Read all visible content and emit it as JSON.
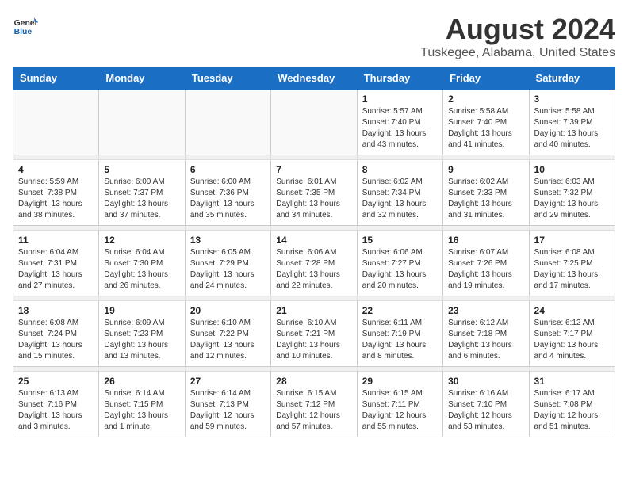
{
  "header": {
    "logo_general": "General",
    "logo_blue": "Blue",
    "month_title": "August 2024",
    "location": "Tuskegee, Alabama, United States"
  },
  "weekdays": [
    "Sunday",
    "Monday",
    "Tuesday",
    "Wednesday",
    "Thursday",
    "Friday",
    "Saturday"
  ],
  "weeks": [
    [
      {
        "day": "",
        "sunrise": "",
        "sunset": "",
        "daylight": ""
      },
      {
        "day": "",
        "sunrise": "",
        "sunset": "",
        "daylight": ""
      },
      {
        "day": "",
        "sunrise": "",
        "sunset": "",
        "daylight": ""
      },
      {
        "day": "",
        "sunrise": "",
        "sunset": "",
        "daylight": ""
      },
      {
        "day": "1",
        "sunrise": "Sunrise: 5:57 AM",
        "sunset": "Sunset: 7:40 PM",
        "daylight": "Daylight: 13 hours and 43 minutes."
      },
      {
        "day": "2",
        "sunrise": "Sunrise: 5:58 AM",
        "sunset": "Sunset: 7:40 PM",
        "daylight": "Daylight: 13 hours and 41 minutes."
      },
      {
        "day": "3",
        "sunrise": "Sunrise: 5:58 AM",
        "sunset": "Sunset: 7:39 PM",
        "daylight": "Daylight: 13 hours and 40 minutes."
      }
    ],
    [
      {
        "day": "4",
        "sunrise": "Sunrise: 5:59 AM",
        "sunset": "Sunset: 7:38 PM",
        "daylight": "Daylight: 13 hours and 38 minutes."
      },
      {
        "day": "5",
        "sunrise": "Sunrise: 6:00 AM",
        "sunset": "Sunset: 7:37 PM",
        "daylight": "Daylight: 13 hours and 37 minutes."
      },
      {
        "day": "6",
        "sunrise": "Sunrise: 6:00 AM",
        "sunset": "Sunset: 7:36 PM",
        "daylight": "Daylight: 13 hours and 35 minutes."
      },
      {
        "day": "7",
        "sunrise": "Sunrise: 6:01 AM",
        "sunset": "Sunset: 7:35 PM",
        "daylight": "Daylight: 13 hours and 34 minutes."
      },
      {
        "day": "8",
        "sunrise": "Sunrise: 6:02 AM",
        "sunset": "Sunset: 7:34 PM",
        "daylight": "Daylight: 13 hours and 32 minutes."
      },
      {
        "day": "9",
        "sunrise": "Sunrise: 6:02 AM",
        "sunset": "Sunset: 7:33 PM",
        "daylight": "Daylight: 13 hours and 31 minutes."
      },
      {
        "day": "10",
        "sunrise": "Sunrise: 6:03 AM",
        "sunset": "Sunset: 7:32 PM",
        "daylight": "Daylight: 13 hours and 29 minutes."
      }
    ],
    [
      {
        "day": "11",
        "sunrise": "Sunrise: 6:04 AM",
        "sunset": "Sunset: 7:31 PM",
        "daylight": "Daylight: 13 hours and 27 minutes."
      },
      {
        "day": "12",
        "sunrise": "Sunrise: 6:04 AM",
        "sunset": "Sunset: 7:30 PM",
        "daylight": "Daylight: 13 hours and 26 minutes."
      },
      {
        "day": "13",
        "sunrise": "Sunrise: 6:05 AM",
        "sunset": "Sunset: 7:29 PM",
        "daylight": "Daylight: 13 hours and 24 minutes."
      },
      {
        "day": "14",
        "sunrise": "Sunrise: 6:06 AM",
        "sunset": "Sunset: 7:28 PM",
        "daylight": "Daylight: 13 hours and 22 minutes."
      },
      {
        "day": "15",
        "sunrise": "Sunrise: 6:06 AM",
        "sunset": "Sunset: 7:27 PM",
        "daylight": "Daylight: 13 hours and 20 minutes."
      },
      {
        "day": "16",
        "sunrise": "Sunrise: 6:07 AM",
        "sunset": "Sunset: 7:26 PM",
        "daylight": "Daylight: 13 hours and 19 minutes."
      },
      {
        "day": "17",
        "sunrise": "Sunrise: 6:08 AM",
        "sunset": "Sunset: 7:25 PM",
        "daylight": "Daylight: 13 hours and 17 minutes."
      }
    ],
    [
      {
        "day": "18",
        "sunrise": "Sunrise: 6:08 AM",
        "sunset": "Sunset: 7:24 PM",
        "daylight": "Daylight: 13 hours and 15 minutes."
      },
      {
        "day": "19",
        "sunrise": "Sunrise: 6:09 AM",
        "sunset": "Sunset: 7:23 PM",
        "daylight": "Daylight: 13 hours and 13 minutes."
      },
      {
        "day": "20",
        "sunrise": "Sunrise: 6:10 AM",
        "sunset": "Sunset: 7:22 PM",
        "daylight": "Daylight: 13 hours and 12 minutes."
      },
      {
        "day": "21",
        "sunrise": "Sunrise: 6:10 AM",
        "sunset": "Sunset: 7:21 PM",
        "daylight": "Daylight: 13 hours and 10 minutes."
      },
      {
        "day": "22",
        "sunrise": "Sunrise: 6:11 AM",
        "sunset": "Sunset: 7:19 PM",
        "daylight": "Daylight: 13 hours and 8 minutes."
      },
      {
        "day": "23",
        "sunrise": "Sunrise: 6:12 AM",
        "sunset": "Sunset: 7:18 PM",
        "daylight": "Daylight: 13 hours and 6 minutes."
      },
      {
        "day": "24",
        "sunrise": "Sunrise: 6:12 AM",
        "sunset": "Sunset: 7:17 PM",
        "daylight": "Daylight: 13 hours and 4 minutes."
      }
    ],
    [
      {
        "day": "25",
        "sunrise": "Sunrise: 6:13 AM",
        "sunset": "Sunset: 7:16 PM",
        "daylight": "Daylight: 13 hours and 3 minutes."
      },
      {
        "day": "26",
        "sunrise": "Sunrise: 6:14 AM",
        "sunset": "Sunset: 7:15 PM",
        "daylight": "Daylight: 13 hours and 1 minute."
      },
      {
        "day": "27",
        "sunrise": "Sunrise: 6:14 AM",
        "sunset": "Sunset: 7:13 PM",
        "daylight": "Daylight: 12 hours and 59 minutes."
      },
      {
        "day": "28",
        "sunrise": "Sunrise: 6:15 AM",
        "sunset": "Sunset: 7:12 PM",
        "daylight": "Daylight: 12 hours and 57 minutes."
      },
      {
        "day": "29",
        "sunrise": "Sunrise: 6:15 AM",
        "sunset": "Sunset: 7:11 PM",
        "daylight": "Daylight: 12 hours and 55 minutes."
      },
      {
        "day": "30",
        "sunrise": "Sunrise: 6:16 AM",
        "sunset": "Sunset: 7:10 PM",
        "daylight": "Daylight: 12 hours and 53 minutes."
      },
      {
        "day": "31",
        "sunrise": "Sunrise: 6:17 AM",
        "sunset": "Sunset: 7:08 PM",
        "daylight": "Daylight: 12 hours and 51 minutes."
      }
    ]
  ]
}
